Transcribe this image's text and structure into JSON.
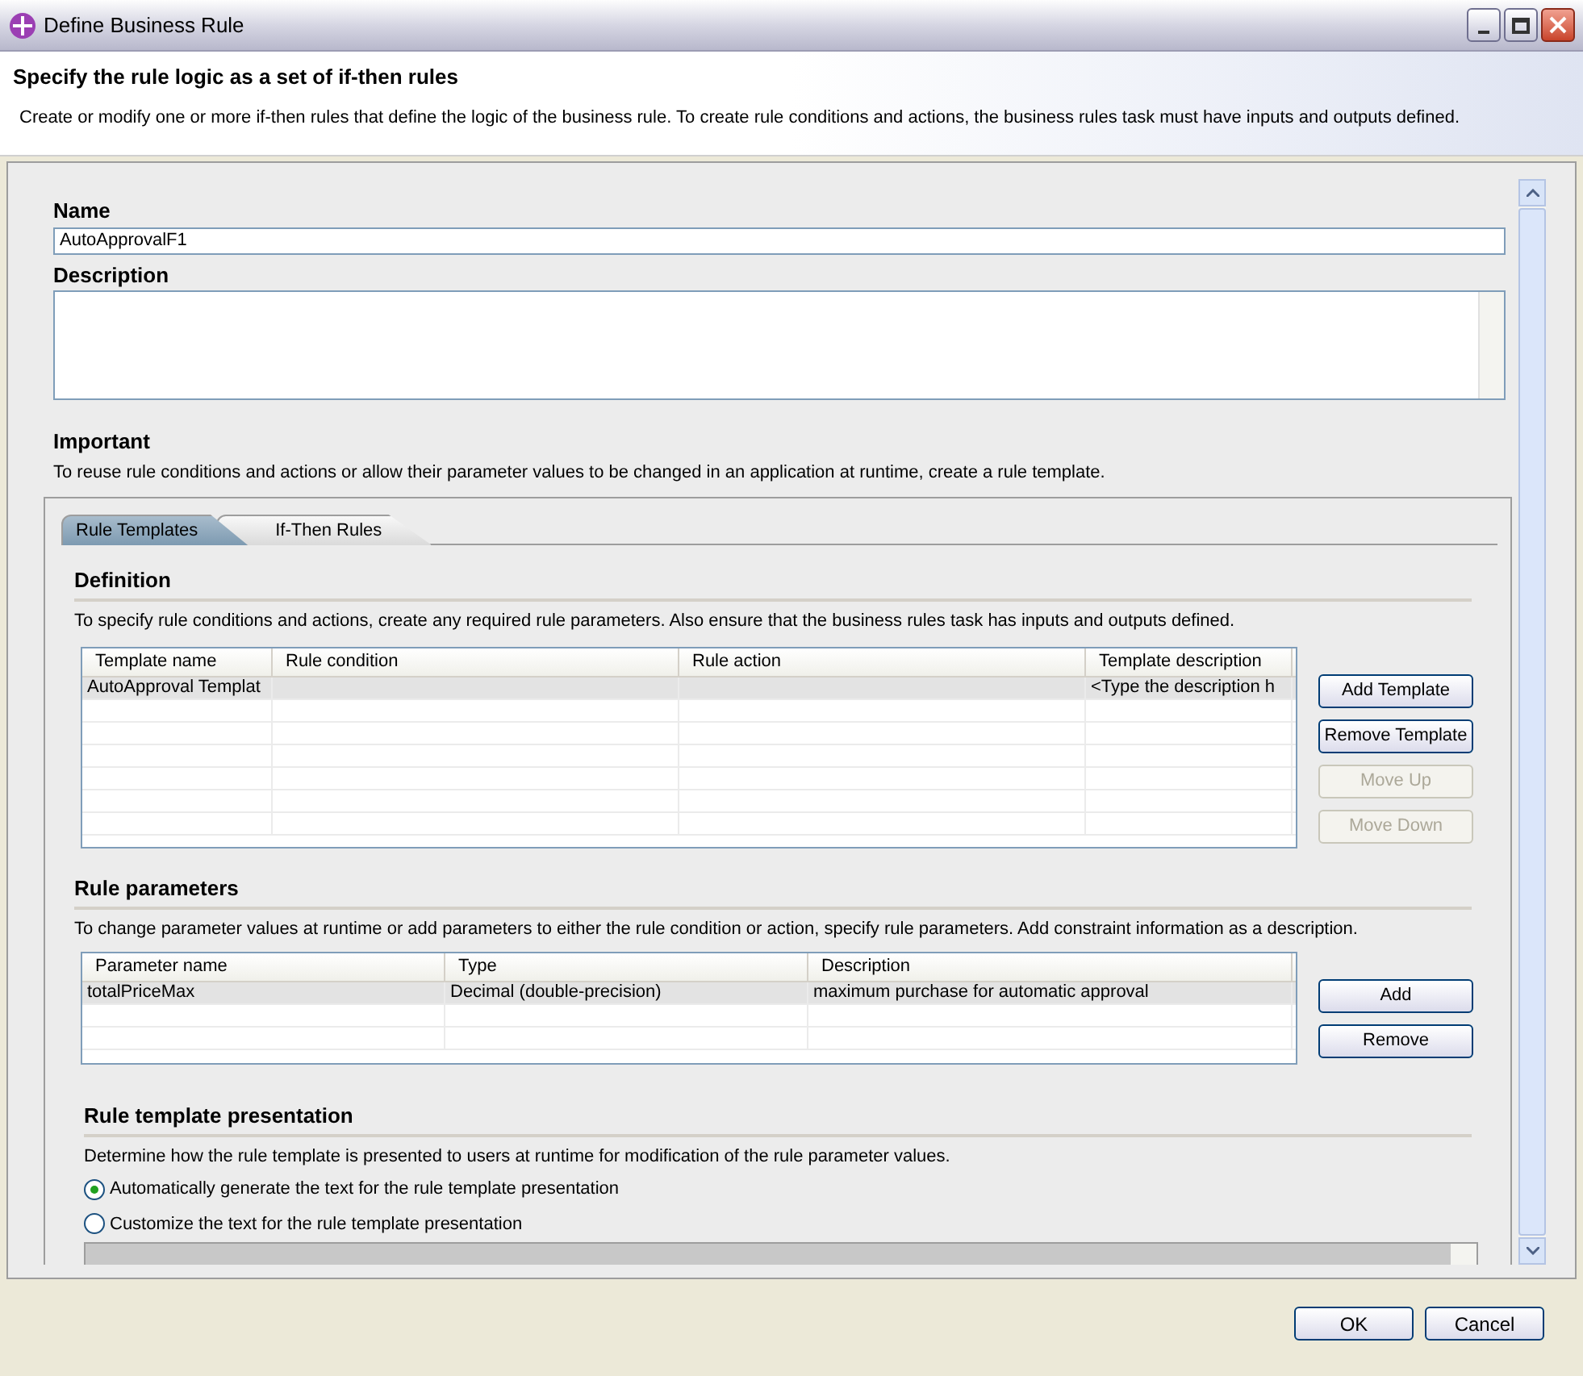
{
  "window": {
    "title": "Define Business Rule"
  },
  "header": {
    "title": "Specify the rule logic as a set of if-then rules",
    "description": "Create or modify one or more if-then rules that define the logic of the business rule. To create rule conditions and actions, the business rules task must have inputs and outputs defined."
  },
  "name": {
    "label": "Name",
    "value": "AutoApprovalF1"
  },
  "description": {
    "label": "Description"
  },
  "important": {
    "title": "Important",
    "text": "To reuse rule conditions and actions or allow their parameter values to be changed in an application at runtime, create a rule template."
  },
  "tabs": [
    {
      "label": "Rule Templates",
      "selected": true
    },
    {
      "label": "If-Then Rules",
      "selected": false
    }
  ],
  "definition": {
    "title": "Definition",
    "text": "To specify rule conditions and actions, create any required rule parameters. Also ensure that the business rules task has inputs and outputs defined.",
    "columns": [
      "Template name",
      "Rule condition",
      "Rule action",
      "Template description"
    ],
    "rows": [
      {
        "cells": [
          "AutoApproval Templat",
          null,
          null,
          "<Type the description h"
        ],
        "selected": true
      }
    ],
    "buttons": [
      {
        "label": "Add Template",
        "disabled": false
      },
      {
        "label": "Remove Template",
        "disabled": false
      },
      {
        "label": "Move Up",
        "disabled": true
      },
      {
        "label": "Move Down",
        "disabled": true
      }
    ]
  },
  "parameters": {
    "title": "Rule parameters",
    "text": "To change parameter values at runtime or add parameters to either the rule condition or action, specify rule parameters. Add constraint information as a description.",
    "columns": [
      "Parameter name",
      "Type",
      "Description"
    ],
    "rows": [
      {
        "cells": [
          "totalPriceMax",
          "Decimal (double-precision)",
          "maximum purchase for automatic approval"
        ],
        "selected": true
      }
    ],
    "buttons": [
      {
        "label": "Add",
        "disabled": false
      },
      {
        "label": "Remove",
        "disabled": false
      }
    ]
  },
  "presentation": {
    "title": "Rule template presentation",
    "text": "Determine how the rule template is presented to users at runtime for modification of the rule parameter values.",
    "options": [
      {
        "label": "Automatically generate the text for the rule template presentation",
        "selected": true
      },
      {
        "label": "Customize the text for the rule template presentation",
        "selected": false
      }
    ]
  },
  "footer_buttons": [
    "OK",
    "Cancel"
  ]
}
